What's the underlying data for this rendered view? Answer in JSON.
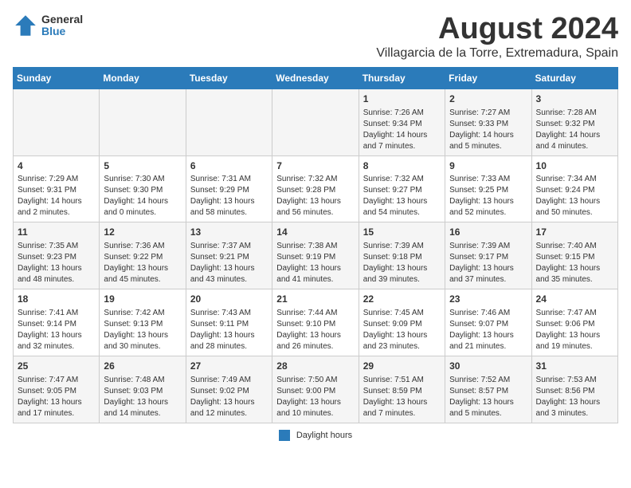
{
  "header": {
    "logo_general": "General",
    "logo_blue": "Blue",
    "month_year": "August 2024",
    "location": "Villagarcia de la Torre, Extremadura, Spain"
  },
  "days_of_week": [
    "Sunday",
    "Monday",
    "Tuesday",
    "Wednesday",
    "Thursday",
    "Friday",
    "Saturday"
  ],
  "weeks": [
    [
      {
        "day": "",
        "info": ""
      },
      {
        "day": "",
        "info": ""
      },
      {
        "day": "",
        "info": ""
      },
      {
        "day": "",
        "info": ""
      },
      {
        "day": "1",
        "info": "Sunrise: 7:26 AM\nSunset: 9:34 PM\nDaylight: 14 hours and 7 minutes."
      },
      {
        "day": "2",
        "info": "Sunrise: 7:27 AM\nSunset: 9:33 PM\nDaylight: 14 hours and 5 minutes."
      },
      {
        "day": "3",
        "info": "Sunrise: 7:28 AM\nSunset: 9:32 PM\nDaylight: 14 hours and 4 minutes."
      }
    ],
    [
      {
        "day": "4",
        "info": "Sunrise: 7:29 AM\nSunset: 9:31 PM\nDaylight: 14 hours and 2 minutes."
      },
      {
        "day": "5",
        "info": "Sunrise: 7:30 AM\nSunset: 9:30 PM\nDaylight: 14 hours and 0 minutes."
      },
      {
        "day": "6",
        "info": "Sunrise: 7:31 AM\nSunset: 9:29 PM\nDaylight: 13 hours and 58 minutes."
      },
      {
        "day": "7",
        "info": "Sunrise: 7:32 AM\nSunset: 9:28 PM\nDaylight: 13 hours and 56 minutes."
      },
      {
        "day": "8",
        "info": "Sunrise: 7:32 AM\nSunset: 9:27 PM\nDaylight: 13 hours and 54 minutes."
      },
      {
        "day": "9",
        "info": "Sunrise: 7:33 AM\nSunset: 9:25 PM\nDaylight: 13 hours and 52 minutes."
      },
      {
        "day": "10",
        "info": "Sunrise: 7:34 AM\nSunset: 9:24 PM\nDaylight: 13 hours and 50 minutes."
      }
    ],
    [
      {
        "day": "11",
        "info": "Sunrise: 7:35 AM\nSunset: 9:23 PM\nDaylight: 13 hours and 48 minutes."
      },
      {
        "day": "12",
        "info": "Sunrise: 7:36 AM\nSunset: 9:22 PM\nDaylight: 13 hours and 45 minutes."
      },
      {
        "day": "13",
        "info": "Sunrise: 7:37 AM\nSunset: 9:21 PM\nDaylight: 13 hours and 43 minutes."
      },
      {
        "day": "14",
        "info": "Sunrise: 7:38 AM\nSunset: 9:19 PM\nDaylight: 13 hours and 41 minutes."
      },
      {
        "day": "15",
        "info": "Sunrise: 7:39 AM\nSunset: 9:18 PM\nDaylight: 13 hours and 39 minutes."
      },
      {
        "day": "16",
        "info": "Sunrise: 7:39 AM\nSunset: 9:17 PM\nDaylight: 13 hours and 37 minutes."
      },
      {
        "day": "17",
        "info": "Sunrise: 7:40 AM\nSunset: 9:15 PM\nDaylight: 13 hours and 35 minutes."
      }
    ],
    [
      {
        "day": "18",
        "info": "Sunrise: 7:41 AM\nSunset: 9:14 PM\nDaylight: 13 hours and 32 minutes."
      },
      {
        "day": "19",
        "info": "Sunrise: 7:42 AM\nSunset: 9:13 PM\nDaylight: 13 hours and 30 minutes."
      },
      {
        "day": "20",
        "info": "Sunrise: 7:43 AM\nSunset: 9:11 PM\nDaylight: 13 hours and 28 minutes."
      },
      {
        "day": "21",
        "info": "Sunrise: 7:44 AM\nSunset: 9:10 PM\nDaylight: 13 hours and 26 minutes."
      },
      {
        "day": "22",
        "info": "Sunrise: 7:45 AM\nSunset: 9:09 PM\nDaylight: 13 hours and 23 minutes."
      },
      {
        "day": "23",
        "info": "Sunrise: 7:46 AM\nSunset: 9:07 PM\nDaylight: 13 hours and 21 minutes."
      },
      {
        "day": "24",
        "info": "Sunrise: 7:47 AM\nSunset: 9:06 PM\nDaylight: 13 hours and 19 minutes."
      }
    ],
    [
      {
        "day": "25",
        "info": "Sunrise: 7:47 AM\nSunset: 9:05 PM\nDaylight: 13 hours and 17 minutes."
      },
      {
        "day": "26",
        "info": "Sunrise: 7:48 AM\nSunset: 9:03 PM\nDaylight: 13 hours and 14 minutes."
      },
      {
        "day": "27",
        "info": "Sunrise: 7:49 AM\nSunset: 9:02 PM\nDaylight: 13 hours and 12 minutes."
      },
      {
        "day": "28",
        "info": "Sunrise: 7:50 AM\nSunset: 9:00 PM\nDaylight: 13 hours and 10 minutes."
      },
      {
        "day": "29",
        "info": "Sunrise: 7:51 AM\nSunset: 8:59 PM\nDaylight: 13 hours and 7 minutes."
      },
      {
        "day": "30",
        "info": "Sunrise: 7:52 AM\nSunset: 8:57 PM\nDaylight: 13 hours and 5 minutes."
      },
      {
        "day": "31",
        "info": "Sunrise: 7:53 AM\nSunset: 8:56 PM\nDaylight: 13 hours and 3 minutes."
      }
    ]
  ],
  "legend": {
    "box_color": "#2b7bba",
    "label": "Daylight hours"
  }
}
